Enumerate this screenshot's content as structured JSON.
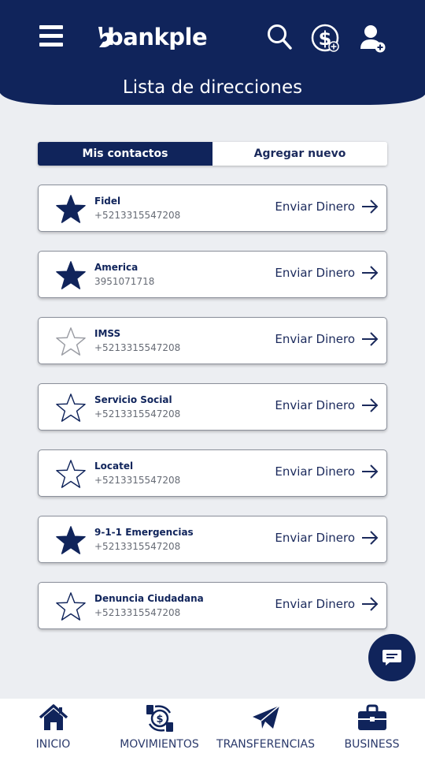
{
  "app": {
    "logo_text": "bankple"
  },
  "header": {
    "title": "Lista de direcciones",
    "icons": [
      "menu-icon",
      "search-icon",
      "dollar-icon",
      "add-user-icon"
    ]
  },
  "tabs": [
    {
      "label": "Mis contactos",
      "active": true
    },
    {
      "label": "Agregar nuevo",
      "active": false
    }
  ],
  "send_label": "Enviar Dinero",
  "contacts": [
    {
      "name": "Fidel",
      "phone": "+5213315547208",
      "favorite": true
    },
    {
      "name": "America",
      "phone": "3951071718",
      "favorite": true
    },
    {
      "name": "IMSS",
      "phone": "+5213315547208",
      "favorite": false
    },
    {
      "name": "Servicio Social",
      "phone": "+5213315547208",
      "favorite": false
    },
    {
      "name": "Locatel",
      "phone": "+5213315547208",
      "favorite": false
    },
    {
      "name": "9-1-1 Emergencias",
      "phone": "+5213315547208",
      "favorite": true
    },
    {
      "name": "Denuncia Ciudadana",
      "phone": "+5213315547208",
      "favorite": false
    }
  ],
  "bottom_nav": [
    {
      "label": "INICIO",
      "icon": "home-icon"
    },
    {
      "label": "MOVIMIENTOS",
      "icon": "exchange-icon"
    },
    {
      "label": "TRANSFERENCIAS",
      "icon": "paper-plane-icon"
    },
    {
      "label": "BUSINESS",
      "icon": "briefcase-icon"
    }
  ],
  "colors": {
    "primary": "#10245b",
    "background": "#eceef2",
    "muted": "#666b75"
  }
}
